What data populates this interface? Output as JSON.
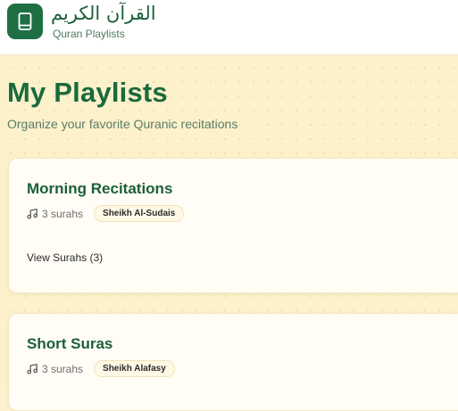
{
  "header": {
    "app_title": "القرآن الكريم",
    "app_subtitle": "Quran Playlists",
    "logo_icon": "book-icon"
  },
  "main": {
    "page_title": "My Playlists",
    "page_description": "Organize your favorite Quranic recitations"
  },
  "playlists": [
    {
      "title": "Morning Recitations",
      "surah_count": "3 surahs",
      "reciter": "Sheikh Al-Sudais",
      "view_label": "View Surahs (3)",
      "icon": "music-note-icon"
    },
    {
      "title": "Short Suras",
      "surah_count": "3 surahs",
      "reciter": "Sheikh Alafasy",
      "icon": "music-note-icon"
    }
  ],
  "colors": {
    "brand_green": "#1f6f45",
    "background": "#fdf1cc",
    "card_background": "#fffdf5"
  }
}
